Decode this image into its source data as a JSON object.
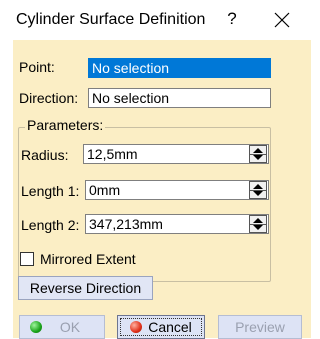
{
  "window": {
    "title": "Cylinder Surface Definition",
    "help_glyph": "?"
  },
  "form": {
    "point_label": "Point:",
    "point_value": "No selection",
    "direction_label": "Direction:",
    "direction_value": "No selection"
  },
  "parameters": {
    "group_title": "Parameters:",
    "radius_label": "Radius:",
    "radius_value": "12,5mm",
    "length1_label": "Length 1:",
    "length1_value": "0mm",
    "length2_label": "Length 2:",
    "length2_value": "347,213mm"
  },
  "options": {
    "mirrored_label": "Mirrored Extent",
    "mirrored_checked": false
  },
  "buttons": {
    "reverse_direction": "Reverse Direction",
    "ok": "OK",
    "cancel": "Cancel",
    "preview": "Preview"
  },
  "colors": {
    "dialog_background": "#fbeec5",
    "selection": "#0078d7"
  },
  "icons": [
    "close-icon",
    "spinner-icon",
    "ok-green-icon",
    "cancel-red-icon"
  ]
}
